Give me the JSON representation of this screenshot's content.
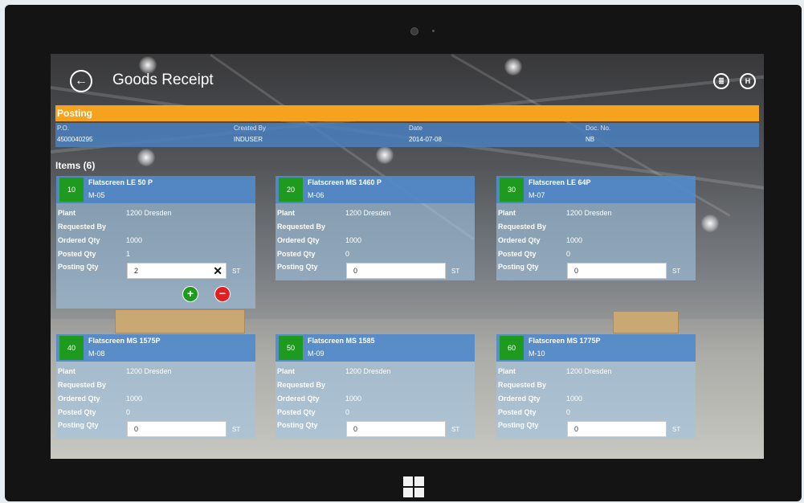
{
  "header": {
    "title": "Goods Receipt",
    "back_icon": "back-arrow-icon",
    "actions": [
      {
        "name": "list-icon",
        "glyph": "≣"
      },
      {
        "name": "save-icon",
        "glyph": "H"
      }
    ]
  },
  "posting": {
    "title": "Posting",
    "fields": [
      {
        "label": "P.O.",
        "value": "4500040295"
      },
      {
        "label": "Created By",
        "value": "INDUSER"
      },
      {
        "label": "Date",
        "value": "2014-07-08"
      },
      {
        "label": "Doc. No.",
        "value": "NB"
      }
    ]
  },
  "items_title": "Items (6)",
  "row_labels": {
    "plant": "Plant",
    "requested_by": "Requested By",
    "ordered_qty": "Ordered Qty",
    "posted_qty": "Posted Qty",
    "posting_qty": "Posting Qty"
  },
  "items": [
    {
      "pos": "10",
      "name": "Flatscreen LE 50 P",
      "code": "M-05",
      "plant": "1200  Dresden",
      "requested_by": "",
      "ordered_qty": "1000",
      "posted_qty": "1",
      "posting_qty": "2",
      "unit": "ST"
    },
    {
      "pos": "20",
      "name": "Flatscreen MS 1460 P",
      "code": "M-06",
      "plant": "1200  Dresden",
      "requested_by": "",
      "ordered_qty": "1000",
      "posted_qty": "0",
      "posting_qty": "0",
      "unit": "ST"
    },
    {
      "pos": "30",
      "name": "Flatscreen LE 64P",
      "code": "M-07",
      "plant": "1200  Dresden",
      "requested_by": "",
      "ordered_qty": "1000",
      "posted_qty": "0",
      "posting_qty": "0",
      "unit": "ST"
    },
    {
      "pos": "40",
      "name": "Flatscreen MS 1575P",
      "code": "M-08",
      "plant": "1200  Dresden",
      "requested_by": "",
      "ordered_qty": "1000",
      "posted_qty": "0",
      "posting_qty": "0",
      "unit": "ST"
    },
    {
      "pos": "50",
      "name": "Flatscreen MS 1585",
      "code": "M-09",
      "plant": "1200  Dresden",
      "requested_by": "",
      "ordered_qty": "1000",
      "posted_qty": "0",
      "posting_qty": "0",
      "unit": "ST"
    },
    {
      "pos": "60",
      "name": "Flatscreen MS 1775P",
      "code": "M-10",
      "plant": "1200  Dresden",
      "requested_by": "",
      "ordered_qty": "1000",
      "posted_qty": "0",
      "posting_qty": "0",
      "unit": "ST"
    }
  ],
  "card_actions": {
    "add_glyph": "+",
    "remove_glyph": "−",
    "clear_glyph": "✕"
  },
  "colors": {
    "accent_orange": "#f5a21f",
    "bar_blue": "#4a80be",
    "badge_green": "#1e9a1e",
    "remove_red": "#e02020"
  }
}
